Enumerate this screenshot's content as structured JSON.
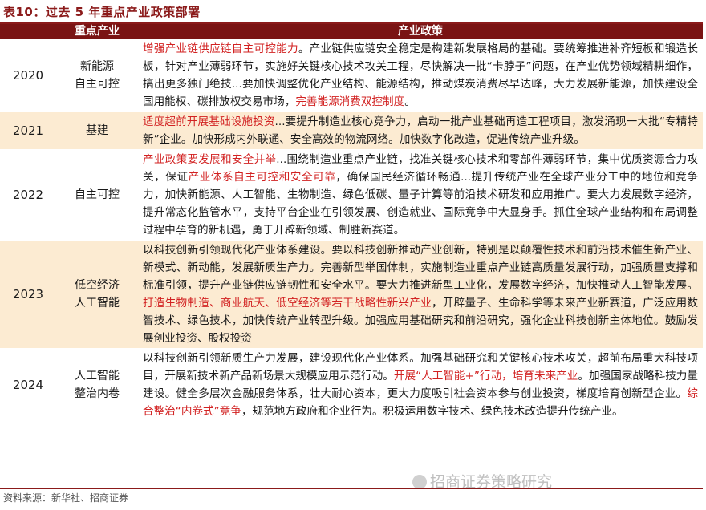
{
  "title": "表10：过去 5 年重点产业政策部署",
  "table": {
    "headers": [
      "",
      "重点产业",
      "产业政策"
    ],
    "rows": [
      {
        "year": "2020",
        "industry": "新能源\n自主可控",
        "shaded": false,
        "segments": [
          {
            "text": "增强产业链供应链自主可控能力",
            "red": true
          },
          {
            "text": "。产业链供应链安全稳定是构建新发展格局的基础。要统筹推进补齐短板和锻造长板，针对产业薄弱环节，实施好关键核心技术攻关工程，尽快解决一批“卡脖子”问题，在产业优势领域精耕细作，搞出更多独门绝技...要加快调整优化产业结构、能源结构，推动煤炭消费尽早达峰，大力发展新能源，加快建设全国用能权、碳排放权交易市场，",
            "red": false
          },
          {
            "text": "完善能源消费双控制度",
            "red": true
          },
          {
            "text": "。",
            "red": false
          }
        ]
      },
      {
        "year": "2021",
        "industry": "基建",
        "shaded": true,
        "segments": [
          {
            "text": "适度超前开展基础设施投资",
            "red": true
          },
          {
            "text": "...要提升制造业核心竞争力，启动一批产业基础再造工程项目，激发涌现一大批“专精特新”企业。加快形成内外联通、安全高效的物流网络。加快数字化改造，促进传统产业升级。",
            "red": false
          }
        ]
      },
      {
        "year": "2022",
        "industry": "自主可控",
        "shaded": false,
        "segments": [
          {
            "text": "产业政策要发展和安全并举",
            "red": true
          },
          {
            "text": "...围绕制造业重点产业链，找准关键核心技术和零部件薄弱环节，集中优质资源合力攻关，保证",
            "red": false
          },
          {
            "text": "产业体系自主可控和安全可靠",
            "red": true
          },
          {
            "text": "，确保国民经济循环畅通...提升传统产业在全球产业分工中的地位和竞争力，加快新能源、人工智能、生物制造、绿色低碳、量子计算等前沿技术研发和应用推广。要大力发展数字经济，提升常态化监管水平，支持平台企业在引领发展、创造就业、国际竞争中大显身手。抓住全球产业结构和布局调整过程中孕育的新机遇，勇于开辟新领域、制胜新赛道。",
            "red": false
          }
        ]
      },
      {
        "year": "2023",
        "industry": "低空经济\n人工智能",
        "shaded": true,
        "segments": [
          {
            "text": "以科技创新引领现代化产业体系建设。要以科技创新推动产业创新，特别是以颠覆性技术和前沿技术催生新产业、新模式、新动能，发展新质生产力。完善新型举国体制，实施制造业重点产业链高质量发展行动，加强质量支撑和标准引领，提升产业链供应链韧性和安全水平。要大力推进新型工业化，发展数字经济，加快推动人工智能发展。",
            "red": false
          },
          {
            "text": "打造生物制造、商业航天、低空经济等若干战略性新兴产业",
            "red": true
          },
          {
            "text": "，开辟量子、生命科学等未来产业新赛道，广泛应用数智技术、绿色技术，加快传统产业转型升级。加强应用基础研究和前沿研究，强化企业科技创新主体地位。鼓励发展创业投资、股权投资",
            "red": false
          }
        ]
      },
      {
        "year": "2024",
        "industry": "人工智能\n整治内卷",
        "shaded": false,
        "segments": [
          {
            "text": "以科技创新引领新质生产力发展，建设现代化产业体系。加强基础研究和关键核心技术攻关，超前布局重大科技项目，开展新技术新产品新场景大规模应用示范行动。",
            "red": false
          },
          {
            "text": "开展“人工智能+”行动，培育未来产业",
            "red": true
          },
          {
            "text": "。加强国家战略科技力量建设。健全多层次金融服务体系，壮大耐心资本，更大力度吸引社会资本参与创业投资，梯度培育创新型企业。",
            "red": false
          },
          {
            "text": "综合整治“内卷式”竞争",
            "red": true
          },
          {
            "text": "，规范地方政府和企业行为。积极运用数字技术、绿色技术改造提升传统产业。",
            "red": false
          }
        ]
      }
    ]
  },
  "source": "资料来源：新华社、招商证券",
  "watermark": "招商证券策略研究"
}
